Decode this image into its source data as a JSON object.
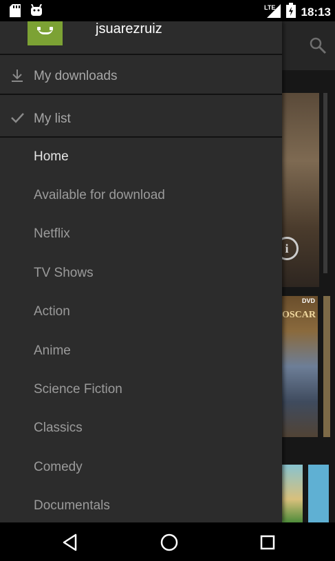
{
  "status_bar": {
    "time": "18:13",
    "network": "LTE",
    "icons": [
      "sd-card-icon",
      "android-icon",
      "signal-icon",
      "battery-icon"
    ]
  },
  "drawer": {
    "username": "jsuarezruiz",
    "pinned": [
      {
        "label": "My downloads",
        "icon": "download-icon"
      },
      {
        "label": "My list",
        "icon": "check-icon"
      }
    ],
    "items": [
      {
        "label": "Home",
        "active": true
      },
      {
        "label": "Available for download"
      },
      {
        "label": "Netflix"
      },
      {
        "label": "TV Shows"
      },
      {
        "label": "Action"
      },
      {
        "label": "Anime"
      },
      {
        "label": "Science Fiction"
      },
      {
        "label": "Classics"
      },
      {
        "label": "Comedy"
      },
      {
        "label": "Documentals"
      }
    ]
  },
  "background": {
    "poster_text": "OSCAR",
    "poster_badge": "DVD",
    "info_glyph": "i"
  },
  "colors": {
    "drawer_bg": "#2c2c2c",
    "avatar_bg": "#7ca234",
    "text_active": "#e6e6e6",
    "text_inactive": "#9b9b9b"
  }
}
